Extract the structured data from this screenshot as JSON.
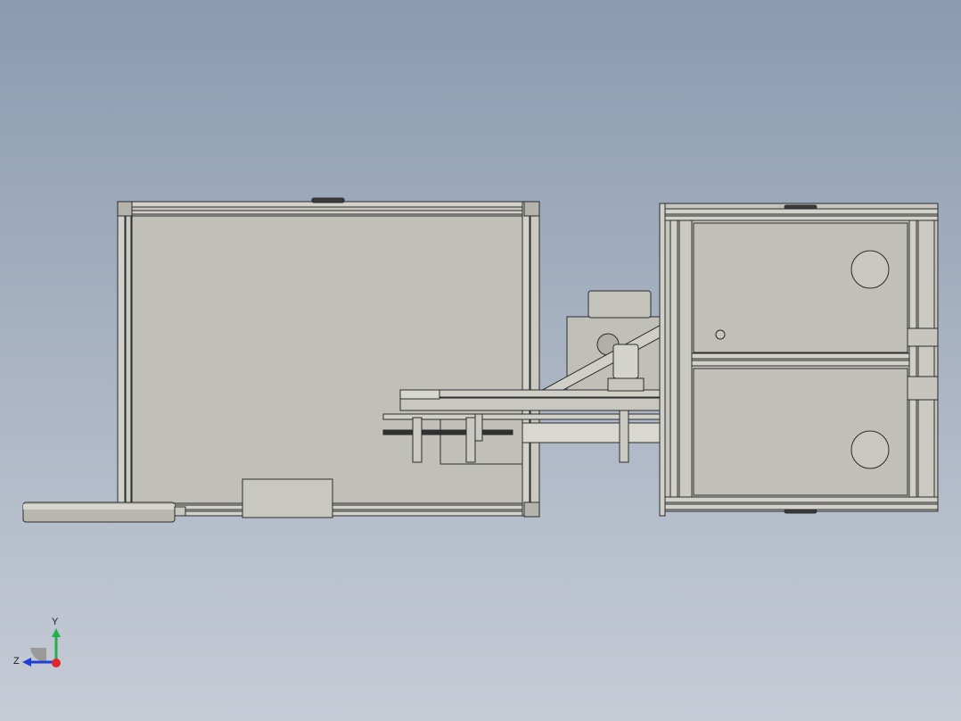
{
  "view": {
    "background_top": "#8a9bb0",
    "background_bottom": "#c6ccd6",
    "model_face_color": "#c2c2ba",
    "model_edge_color": "#2b2b2b"
  },
  "triad": {
    "y_label": "Y",
    "z_label": "Z",
    "y_color": "#1fb24a",
    "z_color": "#1f3fd6",
    "x_color": "#e0262b"
  }
}
